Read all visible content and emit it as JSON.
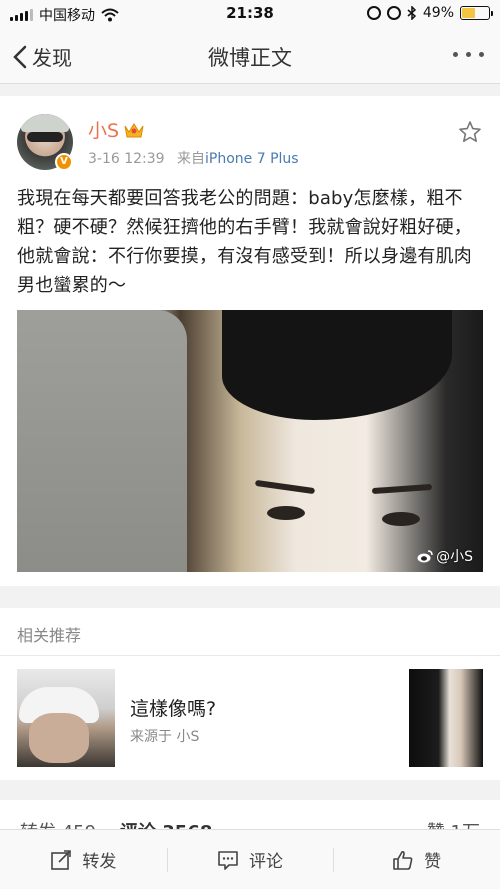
{
  "status_bar": {
    "carrier": "中国移动",
    "time": "21:38",
    "battery": "49%",
    "battery_level": 0.49
  },
  "nav": {
    "back_label": "发现",
    "title": "微博正文"
  },
  "post": {
    "author": "小S",
    "time": "3-16 12:39",
    "source_prefix": "来自",
    "source": "iPhone 7 Plus",
    "text": "我現在每天都要回答我老公的問題：baby怎麼樣，粗不粗？硬不硬？然候狂擠他的右手臂！我就會說好粗好硬，他就會說：不行你要摸，有沒有感受到！所以身邊有肌肉男也蠻累的～",
    "watermark": "@小S"
  },
  "related": {
    "header": "相关推荐",
    "item": {
      "title": "這樣像嗎?",
      "source": "来源于 小S"
    }
  },
  "counts": {
    "reposts_partial": "转发 459",
    "comments_partial": "评论 3568",
    "likes_partial": "赞 1万"
  },
  "toolbar": {
    "repost": "转发",
    "comment": "评论",
    "like": "赞"
  }
}
